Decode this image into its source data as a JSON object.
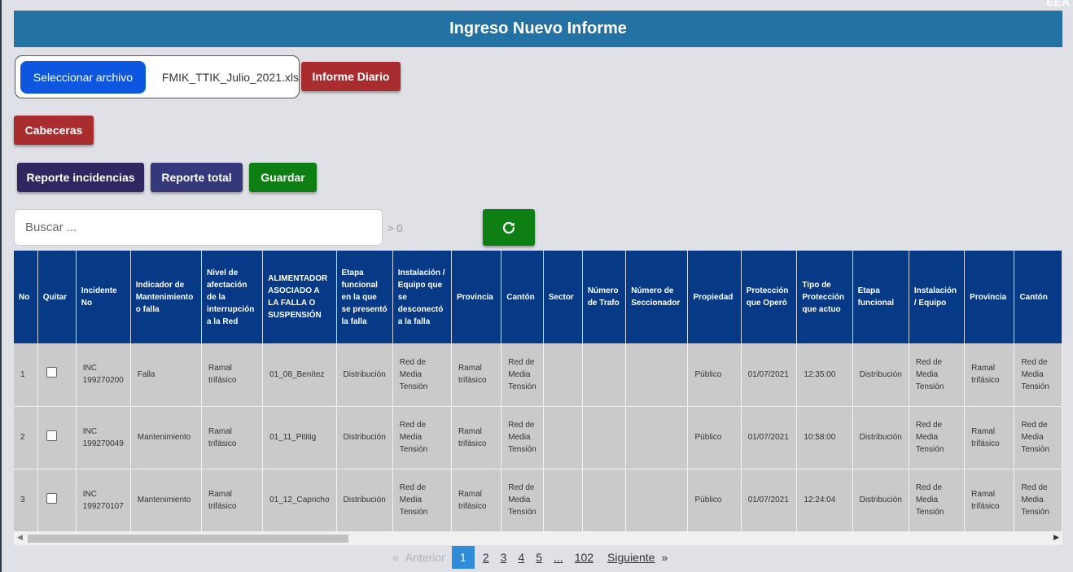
{
  "corner_text": "EEA",
  "header": {
    "title": "Ingreso Nuevo Informe"
  },
  "file": {
    "button_label": "Seleccionar archivo",
    "filename": "FMIK_TTIK_Julio_2021.xls"
  },
  "buttons": {
    "informe_diario": "Informe Diario",
    "cabeceras": "Cabeceras",
    "reporte_incidencias": "Reporte incidencias",
    "reporte_total": "Reporte total",
    "guardar": "Guardar"
  },
  "search": {
    "placeholder": "Buscar ...",
    "count": "> 0"
  },
  "colors": {
    "header": "#2471a3",
    "table_header": "#063a87",
    "red": "#a92d2f",
    "green": "#0e7f12",
    "navy": "#2e2760",
    "indigo": "#35397c",
    "file_button": "#0d57e0",
    "pager_active": "#2f8bd8"
  },
  "table": {
    "columns": [
      "No",
      "Quitar",
      "Incidente No",
      "Indicador de Mantenimiento o falla",
      "Nivel de afectación de la interrupción a la Red",
      "ALIMENTADOR ASOCIADO A LA FALLA O SUSPENSIÓN",
      "Etapa funcional en la que se presentó la falla",
      "Instalación / Equipo que se desconectó a la falla",
      "Provincia",
      "Cantón",
      "Sector",
      "Número de Trafo",
      "Número de Seccionador",
      "Propiedad",
      "Protección que Operó",
      "Tipo de Protección que actuo",
      "Etapa funcional",
      "Instalación / Equipo",
      "Provincia",
      "Cantón"
    ],
    "rows": [
      {
        "no": "1",
        "incidente": "INC 199270200",
        "indicador": "Falla",
        "nivel": "Ramal trifásico",
        "alimentador": "01_08_Benítez",
        "etapa": "Distribución",
        "instalacion": "Red de Media Tensión",
        "provincia": "Ramal trifásico",
        "canton": "Red de Media Tensión",
        "sector": "",
        "trafo": "",
        "seccionador": "",
        "propiedad": "Público",
        "proteccion": "01/07/2021",
        "tipo_proteccion": "12:35:00",
        "etapa2": "Distribución",
        "instalacion2": "Red de Media Tensión",
        "provincia2": "Ramal trifásico",
        "canton2": "Red de Media Tensión"
      },
      {
        "no": "2",
        "incidente": "INC 199270049",
        "indicador": "Mantenimiento",
        "nivel": "Ramal trifásico",
        "alimentador": "01_11_Pititig",
        "etapa": "Distribución",
        "instalacion": "Red de Media Tensión",
        "provincia": "Ramal trifásico",
        "canton": "Red de Media Tensión",
        "sector": "",
        "trafo": "",
        "seccionador": "",
        "propiedad": "Público",
        "proteccion": "01/07/2021",
        "tipo_proteccion": "10:58:00",
        "etapa2": "Distribución",
        "instalacion2": "Red de Media Tensión",
        "provincia2": "Ramal trifásico",
        "canton2": "Red de Media Tensión"
      },
      {
        "no": "3",
        "incidente": "INC 199270107",
        "indicador": "Mantenimiento",
        "nivel": "Ramal trifásico",
        "alimentador": "01_12_Capricho",
        "etapa": "Distribución",
        "instalacion": "Red de Media Tensión",
        "provincia": "Ramal trifásico",
        "canton": "Red de Media Tensión",
        "sector": "",
        "trafo": "",
        "seccionador": "",
        "propiedad": "Público",
        "proteccion": "01/07/2021",
        "tipo_proteccion": "12:24:04",
        "etapa2": "Distribución",
        "instalacion2": "Red de Media Tensión",
        "provincia2": "Ramal trifásico",
        "canton2": "Red de Media Tensión"
      }
    ]
  },
  "pagination": {
    "prev_symbol": "«",
    "prev": "Anterior",
    "pages": [
      "1",
      "2",
      "3",
      "4",
      "5",
      "...",
      "102"
    ],
    "current": "1",
    "next": "Siguiente",
    "next_symbol": "»"
  }
}
